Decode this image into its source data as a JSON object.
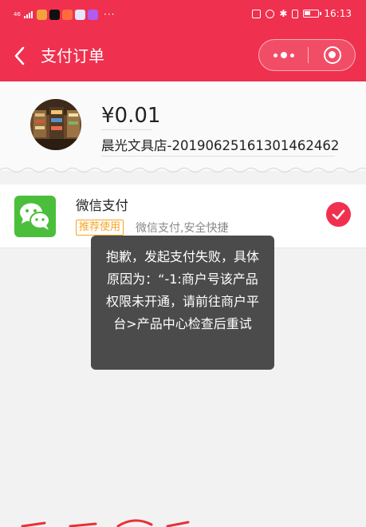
{
  "status_bar": {
    "signal": "46",
    "time": "16:13",
    "battery_level": 0.45
  },
  "header": {
    "title": "支付订单",
    "back_icon": "chevron-left-icon",
    "more_icon": "more-dots-icon",
    "close_icon": "target-circle-icon",
    "background": "#f0304f"
  },
  "order": {
    "amount": "¥0.01",
    "title": "晨光文具店-20190625161301462462"
  },
  "payment": {
    "method": "微信支付",
    "tag": "推荐使用",
    "description": "微信支付,安全快捷",
    "selected": true,
    "icon": "wechat-pay-icon",
    "check_icon": "check-circle-icon",
    "tag_color": "#f5a623",
    "accent": "#f0304f"
  },
  "toast": {
    "message": "抱歉，发起支付失败，具体原因为：“-1:商户号该产品权限未开通，请前往商户平台>产品中心检查后重试"
  }
}
